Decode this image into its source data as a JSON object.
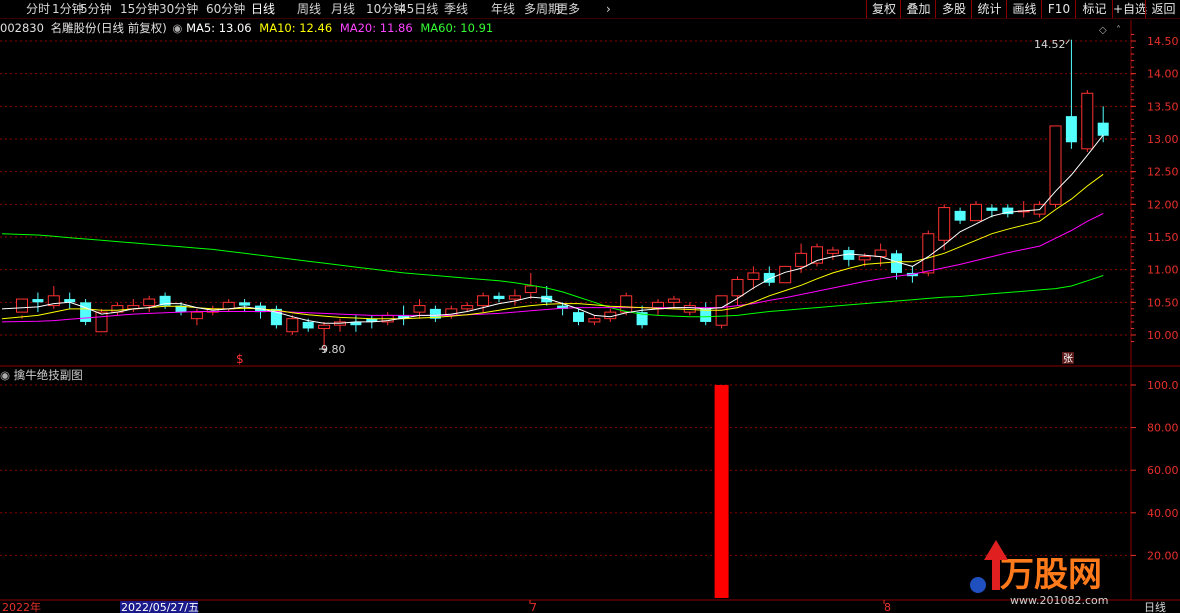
{
  "toolbar": {
    "periods": [
      "分时",
      "1分钟",
      "5分钟",
      "15分钟",
      "30分钟",
      "60分钟",
      "日线",
      "周线",
      "月线",
      "10分钟",
      "45日线",
      "季线",
      "年线",
      "多周期",
      "更多"
    ],
    "active": "日线",
    "right_buttons": [
      "复权",
      "叠加",
      "多股",
      "统计",
      "画线",
      "F10",
      "标记",
      "+自选",
      "返回"
    ]
  },
  "info": {
    "code": "002830",
    "name": "名雕股份",
    "mode": "(日线 前复权)",
    "ma5": "MA5: 13.06",
    "ma10": "MA10: 12.46",
    "ma20": "MA20: 11.86",
    "ma60": "MA60: 10.91"
  },
  "colors": {
    "up": "#ff3232",
    "down": "#54ffff",
    "ma5": "#ffffff",
    "ma10": "#ffff00",
    "ma20": "#ff00ff",
    "ma60": "#00ff00",
    "grid": "#8b0000",
    "axis": "#e8302a"
  },
  "price_axis": {
    "ticks": [
      "14.50",
      "14.00",
      "13.50",
      "13.00",
      "12.50",
      "12.00",
      "11.50",
      "11.00",
      "10.50",
      "10.00"
    ]
  },
  "annotations": {
    "high": "14.52",
    "low": "9.80",
    "marker_left": "$",
    "marker_right": "张"
  },
  "sub_chart": {
    "title": "擒牛绝技副图",
    "ticks": [
      "100.0",
      "80.00",
      "60.00",
      "40.00",
      "20.00"
    ],
    "bar_value": 100
  },
  "time_axis": {
    "labels": [
      "2022年",
      "2022/05/27/五",
      "7",
      "8"
    ],
    "right": "日线"
  },
  "watermark": {
    "brand": "万股网",
    "url": "www.201082.com"
  },
  "chart_data": {
    "type": "candlestick",
    "ylim": [
      9.7,
      14.7
    ],
    "candles": [
      [
        10.35,
        10.55,
        10.25,
        10.3
      ],
      [
        10.55,
        10.5,
        10.35,
        10.65
      ],
      [
        10.45,
        10.6,
        10.4,
        10.75
      ],
      [
        10.55,
        10.5,
        10.4,
        10.65
      ],
      [
        10.5,
        10.2,
        10.15,
        10.55
      ],
      [
        10.05,
        10.35,
        10.05,
        10.4
      ],
      [
        10.35,
        10.45,
        10.3,
        10.5
      ],
      [
        10.4,
        10.45,
        10.35,
        10.55
      ],
      [
        10.45,
        10.55,
        10.35,
        10.6
      ],
      [
        10.6,
        10.45,
        10.4,
        10.65
      ],
      [
        10.45,
        10.35,
        10.3,
        10.5
      ],
      [
        10.25,
        10.35,
        10.15,
        10.4
      ],
      [
        10.35,
        10.4,
        10.3,
        10.45
      ],
      [
        10.4,
        10.5,
        10.35,
        10.55
      ],
      [
        10.5,
        10.45,
        10.35,
        10.55
      ],
      [
        10.45,
        10.35,
        10.25,
        10.5
      ],
      [
        10.4,
        10.15,
        10.1,
        10.45
      ],
      [
        10.05,
        10.25,
        10.0,
        10.3
      ],
      [
        10.2,
        10.1,
        10.05,
        10.25
      ],
      [
        10.1,
        10.15,
        9.8,
        10.2
      ],
      [
        10.15,
        10.2,
        10.05,
        10.25
      ],
      [
        10.2,
        10.15,
        10.05,
        10.3
      ],
      [
        10.25,
        10.2,
        10.1,
        10.3
      ],
      [
        10.2,
        10.3,
        10.15,
        10.35
      ],
      [
        10.3,
        10.25,
        10.15,
        10.45
      ],
      [
        10.35,
        10.45,
        10.25,
        10.55
      ],
      [
        10.4,
        10.25,
        10.2,
        10.45
      ],
      [
        10.3,
        10.4,
        10.25,
        10.45
      ],
      [
        10.4,
        10.45,
        10.35,
        10.5
      ],
      [
        10.45,
        10.6,
        10.35,
        10.65
      ],
      [
        10.6,
        10.55,
        10.5,
        10.65
      ],
      [
        10.55,
        10.6,
        10.45,
        10.7
      ],
      [
        10.65,
        10.75,
        10.55,
        10.95
      ],
      [
        10.6,
        10.5,
        10.45,
        10.75
      ],
      [
        10.45,
        10.4,
        10.3,
        10.5
      ],
      [
        10.35,
        10.2,
        10.15,
        10.4
      ],
      [
        10.2,
        10.25,
        10.15,
        10.3
      ],
      [
        10.25,
        10.35,
        10.2,
        10.4
      ],
      [
        10.35,
        10.6,
        10.3,
        10.65
      ],
      [
        10.35,
        10.15,
        10.1,
        10.45
      ],
      [
        10.4,
        10.5,
        10.3,
        10.55
      ],
      [
        10.5,
        10.55,
        10.4,
        10.6
      ],
      [
        10.35,
        10.45,
        10.3,
        10.5
      ],
      [
        10.4,
        10.2,
        10.15,
        10.5
      ],
      [
        10.15,
        10.6,
        10.1,
        10.6
      ],
      [
        10.6,
        10.85,
        10.45,
        10.9
      ],
      [
        10.85,
        10.95,
        10.7,
        11.05
      ],
      [
        10.95,
        10.8,
        10.75,
        11.05
      ],
      [
        10.8,
        11.05,
        10.8,
        11.05
      ],
      [
        11.05,
        11.25,
        10.95,
        11.4
      ],
      [
        11.1,
        11.35,
        11.05,
        11.4
      ],
      [
        11.25,
        11.3,
        11.15,
        11.35
      ],
      [
        11.3,
        11.15,
        11.05,
        11.35
      ],
      [
        11.15,
        11.2,
        11.05,
        11.25
      ],
      [
        11.2,
        11.3,
        11.05,
        11.4
      ],
      [
        11.25,
        10.95,
        10.85,
        11.3
      ],
      [
        10.95,
        10.9,
        10.8,
        11.05
      ],
      [
        10.95,
        11.55,
        10.9,
        11.6
      ],
      [
        11.45,
        11.95,
        11.3,
        12.0
      ],
      [
        11.9,
        11.75,
        11.7,
        11.95
      ],
      [
        11.75,
        12.0,
        11.75,
        12.05
      ],
      [
        11.95,
        11.9,
        11.8,
        12.0
      ],
      [
        11.95,
        11.85,
        11.8,
        12.0
      ],
      [
        11.9,
        11.9,
        11.8,
        12.05
      ],
      [
        11.85,
        12.0,
        11.8,
        12.05
      ],
      [
        12.0,
        13.2,
        11.95,
        13.2
      ],
      [
        13.35,
        12.95,
        12.85,
        14.52
      ],
      [
        12.85,
        13.7,
        12.8,
        13.75
      ],
      [
        13.25,
        13.05,
        12.95,
        13.5
      ]
    ],
    "ma5": [
      10.4,
      10.43,
      10.48,
      10.5,
      10.42,
      10.32,
      10.35,
      10.4,
      10.42,
      10.48,
      10.48,
      10.42,
      10.38,
      10.4,
      10.43,
      10.4,
      10.35,
      10.28,
      10.22,
      10.18,
      10.18,
      10.2,
      10.2,
      10.22,
      10.26,
      10.3,
      10.3,
      10.32,
      10.36,
      10.42,
      10.48,
      10.52,
      10.58,
      10.56,
      10.48,
      10.4,
      10.3,
      10.28,
      10.34,
      10.38,
      10.4,
      10.42,
      10.42,
      10.4,
      10.42,
      10.56,
      10.72,
      10.86,
      10.96,
      11.02,
      11.14,
      11.2,
      11.24,
      11.22,
      11.2,
      11.12,
      11.05,
      11.2,
      11.38,
      11.58,
      11.7,
      11.82,
      11.88,
      11.9,
      11.92,
      12.2,
      12.45,
      12.75,
      13.06
    ],
    "ma10": [
      10.25,
      10.3,
      10.35,
      10.4,
      10.4,
      10.38,
      10.38,
      10.4,
      10.42,
      10.44,
      10.44,
      10.42,
      10.4,
      10.4,
      10.41,
      10.4,
      10.38,
      10.34,
      10.31,
      10.29,
      10.27,
      10.26,
      10.25,
      10.25,
      10.25,
      10.26,
      10.27,
      10.29,
      10.31,
      10.34,
      10.38,
      10.42,
      10.45,
      10.47,
      10.48,
      10.48,
      10.46,
      10.44,
      10.43,
      10.42,
      10.41,
      10.4,
      10.39,
      10.38,
      10.38,
      10.42,
      10.5,
      10.6,
      10.68,
      10.76,
      10.86,
      10.95,
      11.02,
      11.08,
      11.1,
      11.12,
      11.12,
      11.18,
      11.25,
      11.35,
      11.45,
      11.55,
      11.62,
      11.68,
      11.74,
      11.92,
      12.08,
      12.28,
      12.46
    ],
    "ma20": [
      10.2,
      10.21,
      10.22,
      10.24,
      10.26,
      10.28,
      10.3,
      10.32,
      10.33,
      10.34,
      10.35,
      10.36,
      10.36,
      10.36,
      10.36,
      10.36,
      10.36,
      10.35,
      10.34,
      10.33,
      10.32,
      10.31,
      10.3,
      10.3,
      10.3,
      10.3,
      10.3,
      10.3,
      10.31,
      10.32,
      10.33,
      10.35,
      10.37,
      10.39,
      10.41,
      10.42,
      10.42,
      10.42,
      10.42,
      10.42,
      10.42,
      10.42,
      10.42,
      10.42,
      10.42,
      10.45,
      10.48,
      10.53,
      10.57,
      10.62,
      10.67,
      10.72,
      10.77,
      10.82,
      10.86,
      10.9,
      10.93,
      10.98,
      11.03,
      11.08,
      11.14,
      11.2,
      11.26,
      11.31,
      11.36,
      11.48,
      11.6,
      11.74,
      11.86
    ],
    "ma60": [
      11.55,
      11.53,
      11.51,
      11.49,
      11.47,
      11.45,
      11.43,
      11.41,
      11.39,
      11.37,
      11.35,
      11.33,
      11.31,
      11.28,
      11.25,
      11.22,
      11.19,
      11.16,
      11.13,
      11.1,
      11.07,
      11.04,
      11.01,
      10.98,
      10.95,
      10.93,
      10.91,
      10.89,
      10.87,
      10.85,
      10.83,
      10.8,
      10.76,
      10.72,
      10.66,
      10.58,
      10.5,
      10.42,
      10.36,
      10.32,
      10.3,
      10.29,
      10.28,
      10.28,
      10.29,
      10.3,
      10.33,
      10.36,
      10.38,
      10.4,
      10.42,
      10.44,
      10.46,
      10.48,
      10.5,
      10.52,
      10.54,
      10.56,
      10.58,
      10.59,
      10.61,
      10.63,
      10.65,
      10.67,
      10.69,
      10.71,
      10.75,
      10.83,
      10.91
    ]
  }
}
